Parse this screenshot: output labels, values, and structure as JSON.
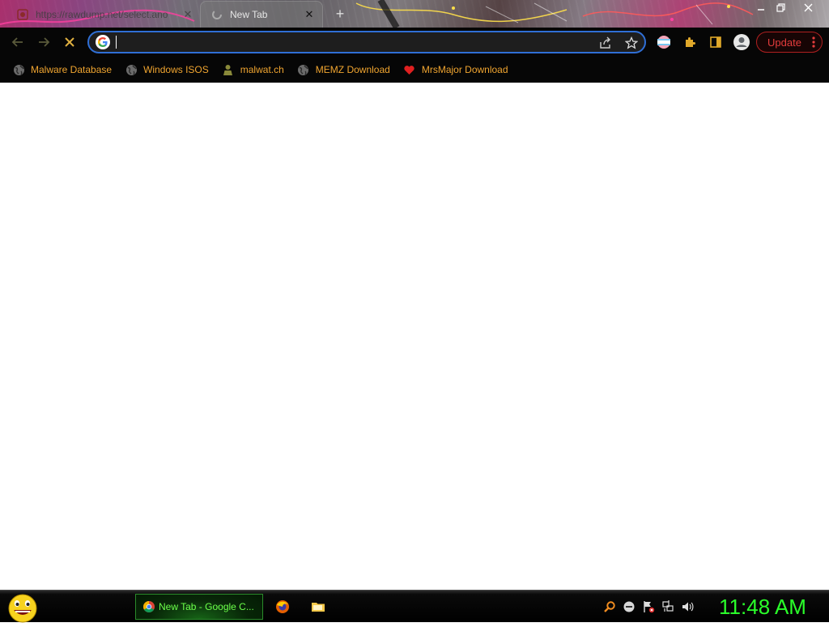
{
  "tabs": [
    {
      "title": "https://rawdump.net/select.ano",
      "active": false
    },
    {
      "title": "New Tab",
      "active": true
    }
  ],
  "toolbar": {
    "omnibox_value": "",
    "update_label": "Update"
  },
  "bookmarks": [
    {
      "label": "Malware Database",
      "icon": "globe-icon"
    },
    {
      "label": "Windows ISOS",
      "icon": "globe-icon"
    },
    {
      "label": "malwat.ch",
      "icon": "person-icon"
    },
    {
      "label": "MEMZ Download",
      "icon": "globe-icon"
    },
    {
      "label": "MrsMajor Download",
      "icon": "heart-icon"
    }
  ],
  "taskbar": {
    "active_task_label": "New Tab - Google C...",
    "clock": "11:48 AM"
  },
  "colors": {
    "bookmark_text": "#f0a530",
    "omnibox_border": "#2f6fd6",
    "update_red": "#e43c3c",
    "clock_green": "#2aff2a",
    "taskbar_green": "#6cff4a"
  }
}
